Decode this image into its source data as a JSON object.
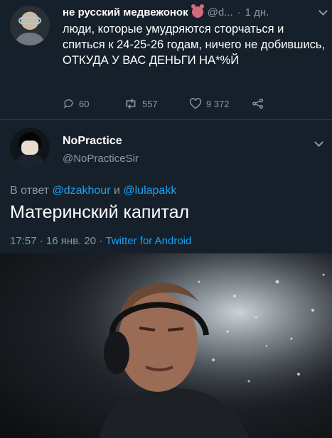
{
  "tweet1": {
    "name": "не русский медвежонок",
    "emoji_icon": "bear-face-icon",
    "handle": "@d...",
    "dot": "·",
    "time": "1 дн.",
    "text": "люди, которые умудряются сторчаться и спиться к 24-25-26 годам, ничего не добившись, ОТКУДА У ВАС ДЕНЬГИ НА*%Й",
    "replies": "60",
    "retweets": "557",
    "likes": "9 372"
  },
  "tweet2": {
    "name": "NoPractice",
    "handle": "@NoPracticeSir",
    "reply_prefix": "В ответ",
    "reply_mention_1": "@dzakhour",
    "reply_and": "и",
    "reply_mention_2": "@lulapakk",
    "text": "Материнский капитал",
    "time": "17:57 · 16 янв. 20 ·",
    "source": "Twitter for Android"
  },
  "colors": {
    "background": "#15202b",
    "secondary_text": "#8899a6",
    "link": "#1da1f2"
  },
  "icons": [
    "reply-icon",
    "retweet-icon",
    "like-icon",
    "share-icon",
    "chevron-down-icon"
  ]
}
